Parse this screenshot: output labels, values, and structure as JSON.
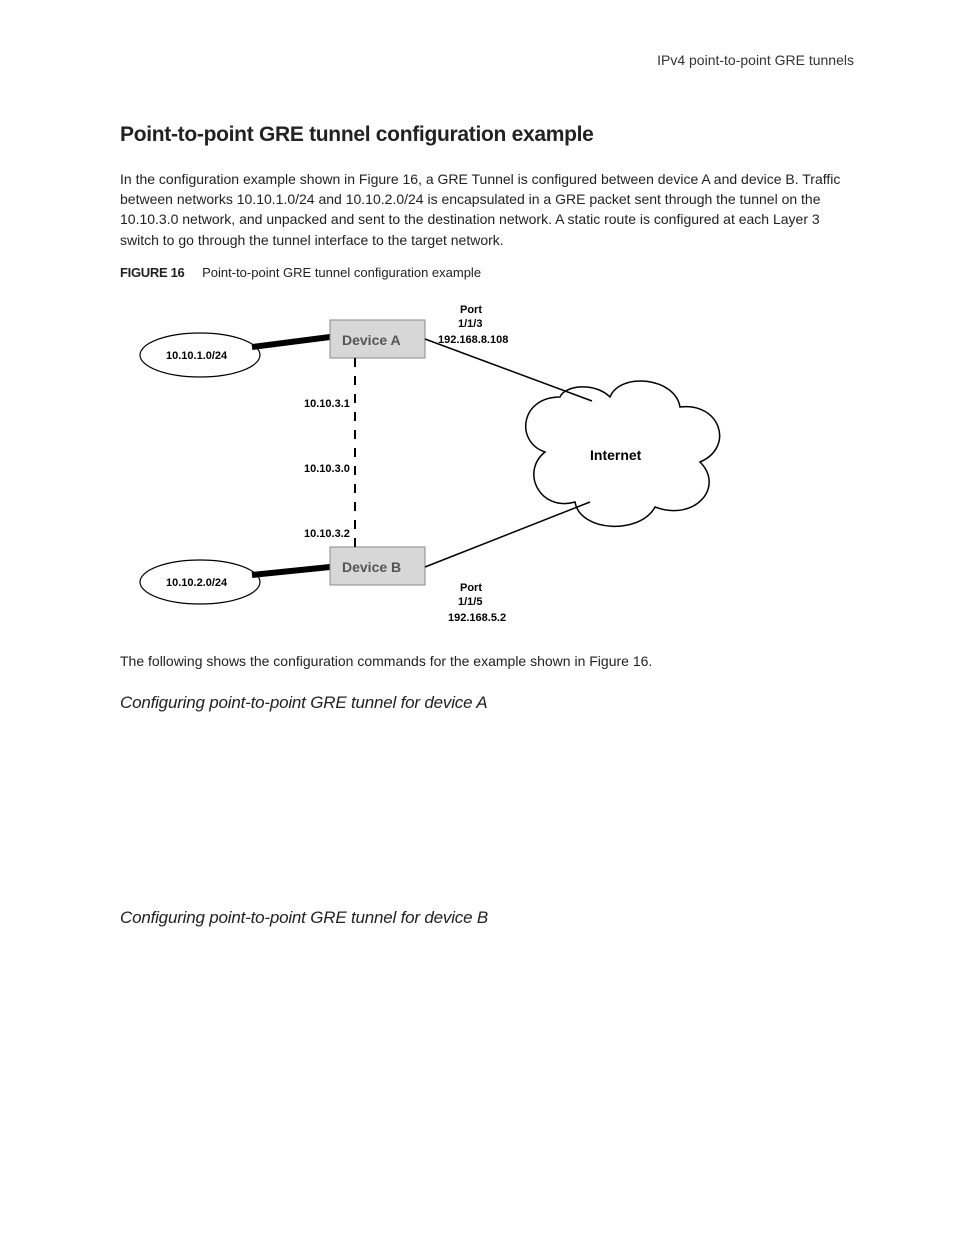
{
  "header": {
    "breadcrumb": "IPv4 point-to-point GRE tunnels"
  },
  "title": "Point-to-point GRE tunnel configuration example",
  "intro": "In the configuration example shown in Figure 16, a GRE Tunnel is configured between device A and device B. Traffic between networks 10.10.1.0/24 and 10.10.2.0/24 is encapsulated in a GRE packet sent through the tunnel on the 10.10.3.0 network, and unpacked and sent to the destination network. A static route is configured at each Layer 3 switch to go through the tunnel interface to the target network.",
  "figure": {
    "label": "FIGURE 16",
    "caption": "Point-to-point GRE tunnel configuration example"
  },
  "diagram": {
    "deviceA": "Device A",
    "deviceB": "Device B",
    "netA": "10.10.1.0/24",
    "netB": "10.10.2.0/24",
    "tunnelA": "10.10.3.1",
    "tunnelNet": "10.10.3.0",
    "tunnelB": "10.10.3.2",
    "portA_label": "Port",
    "portA_num": "1/1/3",
    "portA_ip": "192.168.8.108",
    "portB_label": "Port",
    "portB_num": "1/1/5",
    "portB_ip": "192.168.5.2",
    "internet": "Internet"
  },
  "post_figure": "The following shows the configuration commands for the example shown in Figure 16.",
  "sectionA": "Configuring point-to-point GRE tunnel for device A",
  "sectionB": "Configuring point-to-point GRE tunnel for device B"
}
